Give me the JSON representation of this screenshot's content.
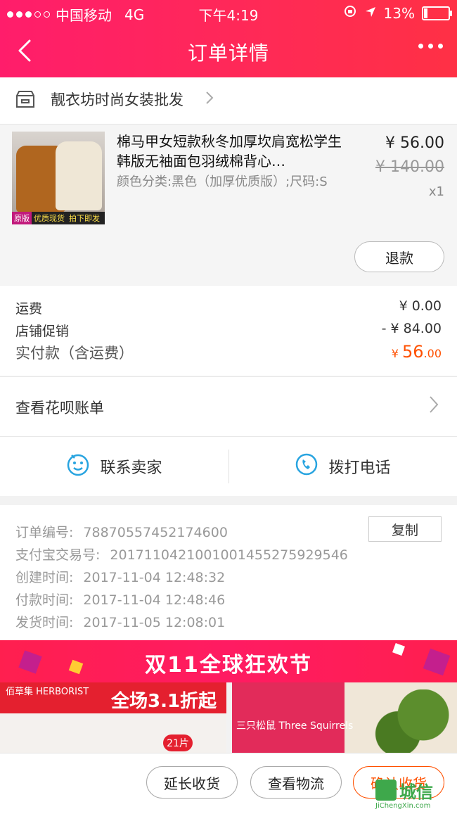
{
  "status_bar": {
    "carrier": "中国移动",
    "network": "4G",
    "time": "下午4:19",
    "battery": "13%",
    "battery_level": 0.13
  },
  "nav": {
    "title": "订单详情"
  },
  "shop": {
    "name": "靓衣坊时尚女装批发"
  },
  "product": {
    "title": "棉马甲女短款秋冬加厚坎肩宽松学生韩版无袖面包羽绒棉背心…",
    "spec": "颜色分类:黑色（加厚优质版）;尺码:S",
    "price": "¥ 56.00",
    "original_price": "¥ 140.00",
    "quantity": "x1",
    "refund_label": "退款",
    "thumb_tags": [
      "原版",
      "优质现货",
      "拍下即发"
    ]
  },
  "fees": {
    "shipping_label": "运费",
    "shipping_value": "¥ 0.00",
    "promo_label": "店铺促销",
    "promo_value": "- ¥ 84.00",
    "paid_label": "实付款（含运费）",
    "paid_symbol": "¥ ",
    "paid_integer": "56",
    "paid_decimal": ".00"
  },
  "huabei": {
    "label": "查看花呗账单"
  },
  "contact": {
    "seller_label": "联系卖家",
    "phone_label": "拨打电话"
  },
  "order_info": {
    "order_no_label": "订单编号:",
    "order_no": "78870557452174600",
    "alipay_label": "支付宝交易号:",
    "alipay_no": "2017110421001001455275929546",
    "created_label": "创建时间:",
    "created": "2017-11-04 12:48:32",
    "paid_label": "付款时间:",
    "paid": "2017-11-04 12:48:46",
    "shipped_label": "发货时间:",
    "shipped": "2017-11-05 12:08:01",
    "copy_label": "复制"
  },
  "banner": {
    "text": "双11全球狂欢节",
    "left_brand": "佰草集 HERBORIST",
    "left_promo": "全场3.1折起",
    "left_count": "21片",
    "right_brand": "三只松鼠 Three Squirrels"
  },
  "bottom_bar": {
    "extend_label": "延长收货",
    "logistics_label": "查看物流",
    "confirm_label": "确认收货"
  },
  "watermark": {
    "text": "城信",
    "sub": "JiChengXin.com"
  },
  "colors": {
    "brand_gradient_start": "#ff1d6b",
    "brand_gradient_end": "#ff3045",
    "accent_orange": "#ff5000"
  }
}
